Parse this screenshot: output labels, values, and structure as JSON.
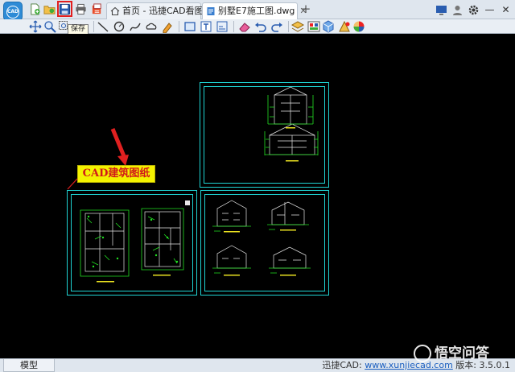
{
  "app": {
    "logo_text": "CAD",
    "brand_color": "#2e8bd6"
  },
  "tabs": [
    {
      "label": "首页 - 迅捷CAD看图",
      "icon": "home-icon",
      "active": false
    },
    {
      "label": "别墅E7施工图.dwg",
      "icon": "dwg-file-icon",
      "active": true
    }
  ],
  "quick_access": [
    "new-file-icon",
    "open-file-icon",
    "save-icon",
    "print-icon",
    "batch-print-icon"
  ],
  "tooltip": {
    "text": "保存"
  },
  "toolbar": {
    "tools": [
      "pan-icon",
      "zoom-icon",
      "zoom-window-icon",
      "line-icon",
      "circle-icon",
      "polyline-icon",
      "revision-cloud-icon",
      "text-annotation-icon",
      "rectangle-icon",
      "text-icon",
      "measure-icon",
      "eraser-icon",
      "undo-icon",
      "redo-icon",
      "layer-icon",
      "layer-color-icon",
      "3d-view-icon",
      "color-icon",
      "palette-icon"
    ]
  },
  "annotation": {
    "label": "CAD建筑图纸",
    "arrow_color": "#e02020",
    "label_bg": "#f4f200"
  },
  "window_controls": [
    "screen-icon",
    "user-icon",
    "settings-icon",
    "minimize-icon",
    "close-icon"
  ],
  "statusbar": {
    "model_tab": "模型",
    "site_prefix": "迅捷CAD: ",
    "site_link": "www.xunjiecad.com",
    "version": " 版本: 3.5.0.1"
  },
  "watermark": {
    "text": "悟空问答"
  },
  "colors": {
    "sheet_border": "#1fd3d3",
    "drawing_green": "#22e022",
    "drawing_white": "#e6e6e6",
    "drawing_yellow": "#e8e020"
  }
}
